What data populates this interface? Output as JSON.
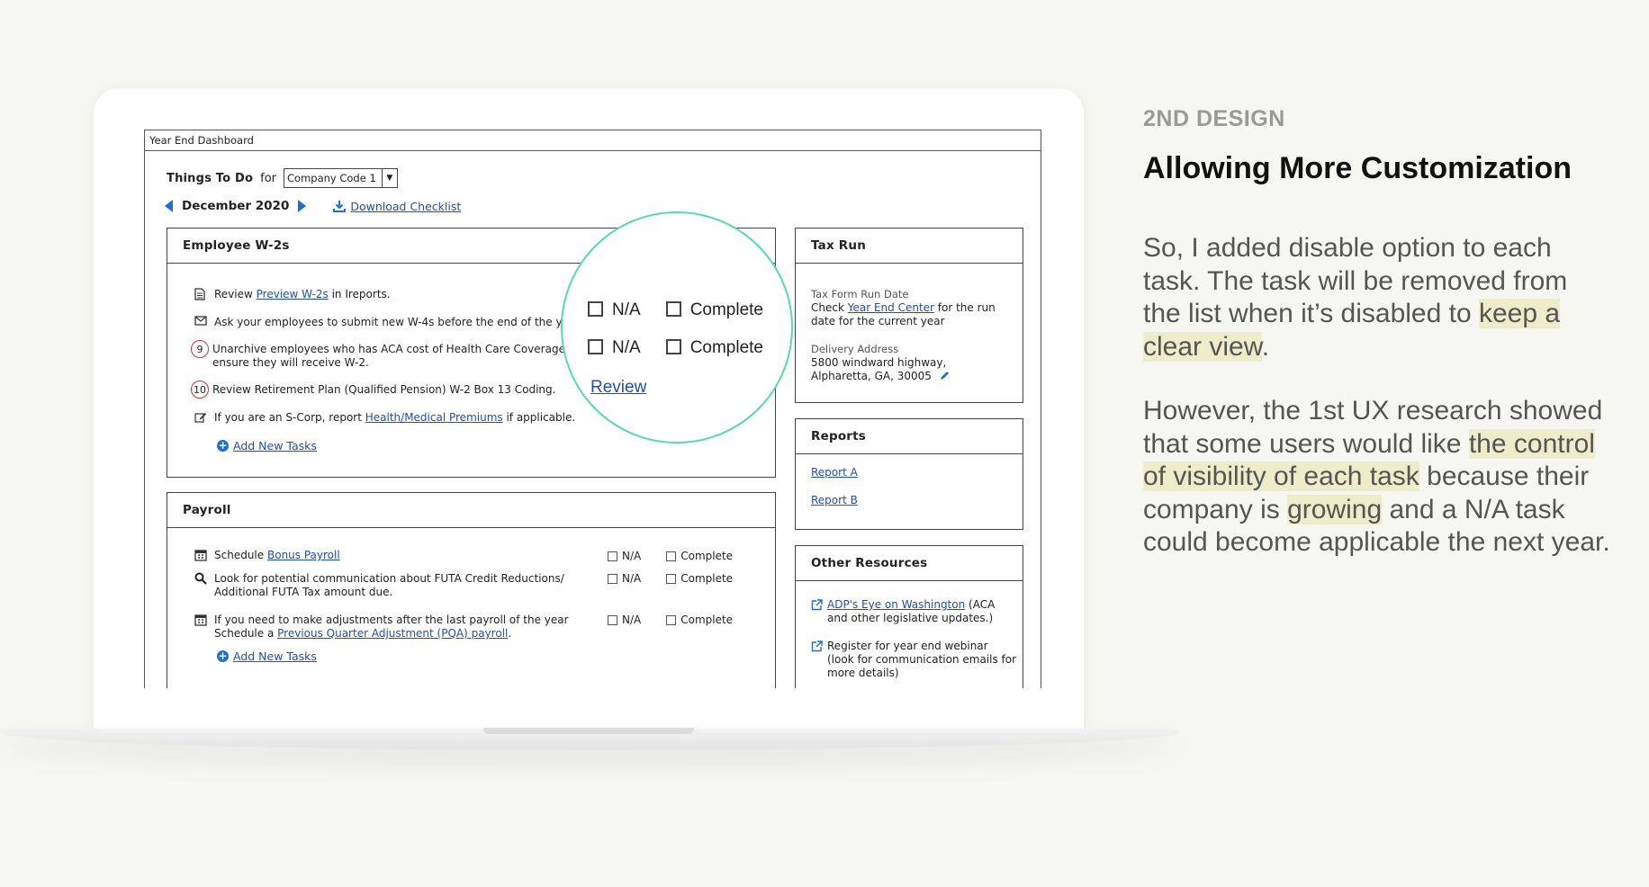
{
  "window": {
    "title": "Year End Dashboard"
  },
  "todo": {
    "label": "Things To Do",
    "for_label": "for",
    "company_select": "Company Code 1"
  },
  "month": {
    "label": "December 2020",
    "download_label": "Download Checklist"
  },
  "employee_w2": {
    "title": "Employee W-2s",
    "tasks": [
      {
        "prefix": "Review ",
        "link": "Preview W-2s",
        "suffix": " in Ireports."
      },
      {
        "text": "Ask your employees to submit new W-4s before the end of the yea"
      },
      {
        "num": "9",
        "line1": "Unarchive employees who has ACA cost of Health Care Coverage t",
        "line2": "ensure they will receive W-2."
      },
      {
        "num": "10",
        "text": "Review Retirement Plan (Qualified Pension) W-2 Box 13 Coding."
      },
      {
        "prefix": "If you are an S-Corp, report ",
        "link": "Health/Medical Premiums",
        "suffix": " if applicable."
      }
    ],
    "add_label": "Add New Tasks"
  },
  "payroll": {
    "title": "Payroll",
    "tasks": [
      {
        "prefix": "Schedule ",
        "link": "Bonus Payroll"
      },
      {
        "line1": "Look for potential communication about FUTA Credit Reductions/",
        "line2": "Additional FUTA Tax amount due."
      },
      {
        "line1": "If you need to make adjustments after the last payroll of the year",
        "line2_prefix": "Schedule a ",
        "line2_link": "Previous Quarter Adjustment (PQA) payroll",
        "line2_suffix": "."
      }
    ],
    "na_label": "N/A",
    "complete_label": "Complete",
    "add_label": "Add New Tasks"
  },
  "zoom": {
    "na_label": "N/A",
    "complete_label": "Complete",
    "review_label": "Review"
  },
  "tax_run": {
    "title": "Tax Run",
    "form_date_label": "Tax Form Run Date",
    "check_prefix": "Check ",
    "check_link": "Year End Center",
    "check_suffix": " for the run",
    "check_line2": "date for the current year",
    "delivery_label": "Delivery Address",
    "address_line1": "5800 windward highway,",
    "address_line2": "Alpharetta, GA, 30005"
  },
  "reports": {
    "title": "Reports",
    "items": [
      "Report A",
      "Report B"
    ]
  },
  "other_resources": {
    "title": "Other Resources",
    "item1_link": "ADP's Eye on Washington",
    "item1_suffix": " (ACA",
    "item1_line2": "and other legislative updates.)",
    "item2_line1": "Register for year end webinar",
    "item2_line2": "(look for communication emails for",
    "item2_line3": "more details)"
  },
  "side": {
    "caption": "2ND DESIGN",
    "title": "Allowing More Customization",
    "p1_a": "So, I added disable option to each task. The task will be removed from the list when it’s disabled to ",
    "p1_hl": "keep a clear view",
    "p1_b": ".",
    "p2_a": "However, the 1st UX research showed that some users would like ",
    "p2_hl1": "the control of visibility of each task",
    "p2_b": " because their company is ",
    "p2_hl2": "growing",
    "p2_c": " and a N/A task could become applicable the next year."
  },
  "colors": {
    "accent_link": "#1f4fb5",
    "zoom_ring": "#58d8b4",
    "highlight": "#efedc9",
    "badge_red": "#d43030"
  }
}
